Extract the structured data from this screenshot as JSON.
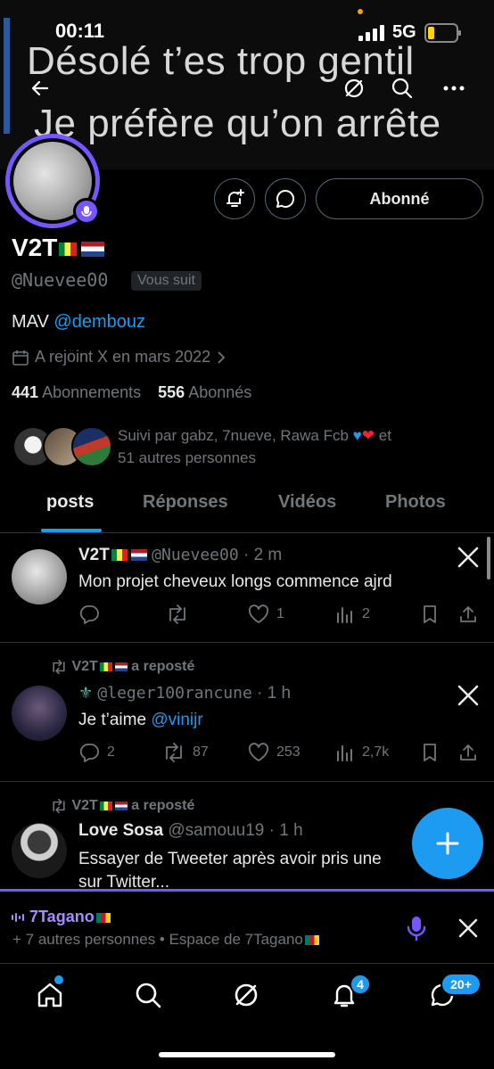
{
  "status_bar": {
    "time": "00:11",
    "network": "5G"
  },
  "banner": {
    "line1": "Désolé t’es trop gentil",
    "line2": "Je préfère qu’on arrête"
  },
  "profile": {
    "name": "V2T",
    "handle": "@Nuevee00",
    "follows_you": "Vous suit",
    "bio_text": "MAV ",
    "bio_mention": "@dembouz",
    "joined": "A rejoint X en mars 2022",
    "following_count": "441",
    "following_label": "Abonnements",
    "followers_count": "556",
    "followers_label": "Abonnés",
    "followed_by_line1": "Suivi par gabz, 7nueve, Rawa Fcb",
    "followed_by_and": "et",
    "followed_by_line2": "51 autres personnes",
    "follow_button": "Abonné"
  },
  "tabs": [
    {
      "label": "posts",
      "active": true
    },
    {
      "label": "Réponses",
      "active": false
    },
    {
      "label": "Vidéos",
      "active": false
    },
    {
      "label": "Photos",
      "active": false
    }
  ],
  "posts": [
    {
      "author": "V2T",
      "handle": "@Nuevee00",
      "time": "· 2 m",
      "text": "Mon projet cheveux longs commence ajrd",
      "replies": "",
      "reposts": "",
      "likes": "1",
      "views": "2"
    },
    {
      "repost_by": "V2T",
      "repost_label": "a reposté",
      "author": "",
      "handle": "@leger100rancune",
      "time": "· 1 h",
      "text": "Je t’aime ",
      "mention": "@vinijr",
      "replies": "2",
      "reposts": "87",
      "likes": "253",
      "views": "2,7k"
    },
    {
      "repost_by": "V2T",
      "repost_label": "a reposté",
      "author": "Love Sosa",
      "handle": "@samouu19",
      "time": "· 1 h",
      "text_line1": "Essayer de Tweeter après avoir pris une",
      "text_line2": "sur Twitter..."
    }
  ],
  "space_bar": {
    "host": "7Tagano",
    "subtitle": "+ 7 autres personnes • Espace de 7Tagano"
  },
  "bottom_nav": {
    "notifications_badge": "4",
    "messages_badge": "20+"
  },
  "colors": {
    "accent": "#1d9bf0",
    "space_purple": "#7856ff",
    "like_heart": "#f91880"
  }
}
